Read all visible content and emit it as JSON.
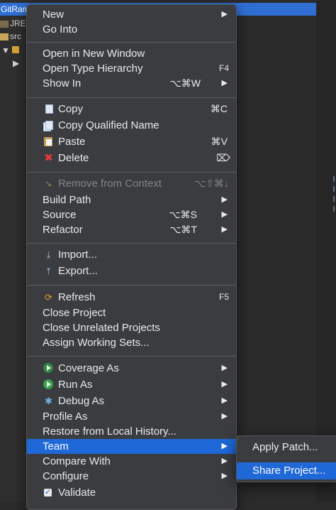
{
  "tree": {
    "project_label": "GitRam",
    "rows": [
      "JRE",
      "src"
    ]
  },
  "menu": {
    "new": "New",
    "go_into": "Go Into",
    "open_new_window": "Open in New Window",
    "open_type_hierarchy": "Open Type Hierarchy",
    "open_type_hierarchy_sc": "F4",
    "show_in": "Show In",
    "show_in_sc": "⌥⌘W",
    "copy": "Copy",
    "copy_sc": "⌘C",
    "copy_qualified": "Copy Qualified Name",
    "paste": "Paste",
    "paste_sc": "⌘V",
    "delete": "Delete",
    "delete_sc": "⌦",
    "remove_context": "Remove from Context",
    "remove_context_sc": "⌥⇧⌘↓",
    "build_path": "Build Path",
    "source": "Source",
    "source_sc": "⌥⌘S",
    "refactor": "Refactor",
    "refactor_sc": "⌥⌘T",
    "import": "Import...",
    "export": "Export...",
    "refresh": "Refresh",
    "refresh_sc": "F5",
    "close_project": "Close Project",
    "close_unrelated": "Close Unrelated Projects",
    "assign_sets": "Assign Working Sets...",
    "coverage_as": "Coverage As",
    "run_as": "Run As",
    "debug_as": "Debug As",
    "profile_as": "Profile As",
    "restore_history": "Restore from Local History...",
    "team": "Team",
    "compare_with": "Compare With",
    "configure": "Configure",
    "validate": "Validate",
    "arrow": "▶"
  },
  "submenu": {
    "apply_patch": "Apply Patch...",
    "share_project": "Share Project..."
  },
  "colors": {
    "menu_bg": "#3a3c40",
    "selection": "#1f68d8",
    "tree_selection": "#2f6fd3"
  }
}
